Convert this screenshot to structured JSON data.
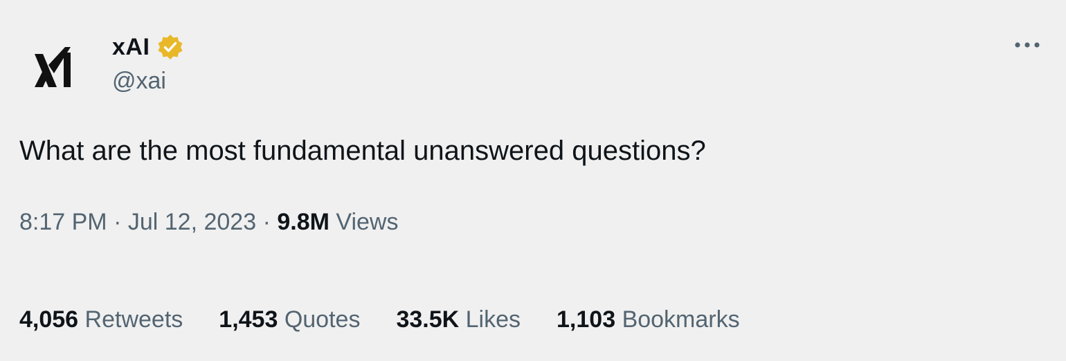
{
  "author": {
    "display_name": "xAI",
    "handle": "@xai",
    "verified_icon": "verified-gold-badge-icon",
    "avatar_icon": "xai-logo-icon"
  },
  "more_icon": "more-horizontal-icon",
  "tweet": {
    "text": "What are the most fundamental unanswered questions?"
  },
  "meta": {
    "time": "8:17 PM",
    "separator": "·",
    "date": "Jul 12, 2023",
    "views_count": "9.8M",
    "views_label": "Views"
  },
  "stats": [
    {
      "count": "4,056",
      "label": "Retweets"
    },
    {
      "count": "1,453",
      "label": "Quotes"
    },
    {
      "count": "33.5K",
      "label": "Likes"
    },
    {
      "count": "1,103",
      "label": "Bookmarks"
    }
  ],
  "colors": {
    "background": "#f0f0f0",
    "primary_text": "#0f1419",
    "secondary_text": "#536471",
    "badge_gold": "#e8b829"
  }
}
